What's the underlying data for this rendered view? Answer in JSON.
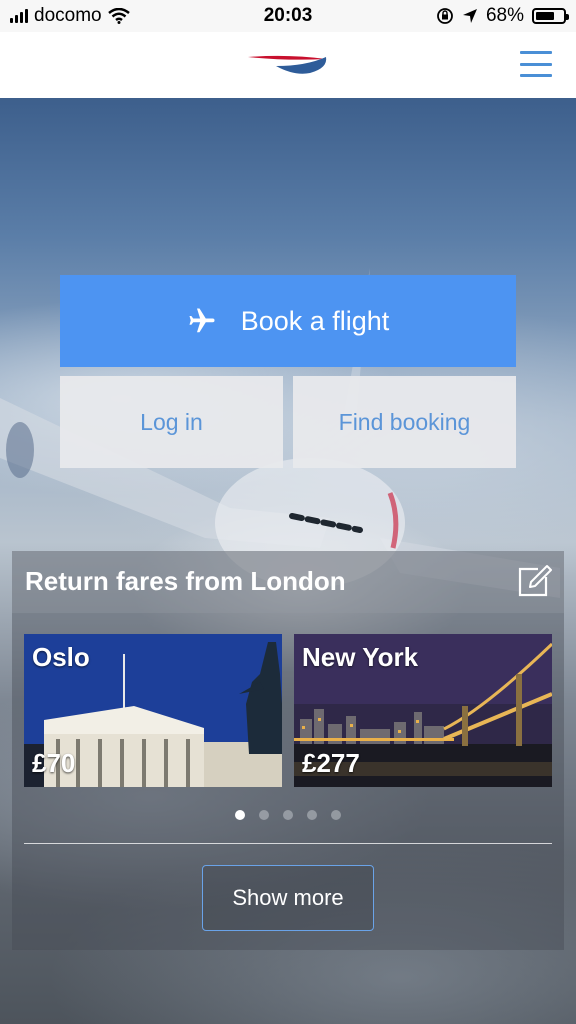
{
  "status_bar": {
    "carrier": "docomo",
    "time": "20:03",
    "battery": "68%",
    "battery_level": 0.68,
    "icons": [
      "signal-icon",
      "wifi-icon",
      "orientation-lock-icon",
      "location-arrow-icon",
      "battery-icon"
    ]
  },
  "header": {
    "logo": "british-airways-speedmarque-logo",
    "menu_icon": "hamburger-menu-icon"
  },
  "actions": {
    "book_flight": "Book a flight",
    "book_flight_icon": "airplane-icon",
    "log_in": "Log in",
    "find_booking": "Find booking"
  },
  "fares": {
    "title": "Return fares from London",
    "edit_icon": "edit-icon",
    "cards": [
      {
        "city": "Oslo",
        "price": "£70"
      },
      {
        "city": "New York",
        "price": "£277"
      }
    ],
    "pager": {
      "total": 5,
      "active": 1
    },
    "show_more": "Show more"
  },
  "colors": {
    "primary_button": "#4d94f2",
    "secondary_button_text": "#5b95d8",
    "logo_red": "#c8102e",
    "logo_blue": "#2e5c99"
  }
}
